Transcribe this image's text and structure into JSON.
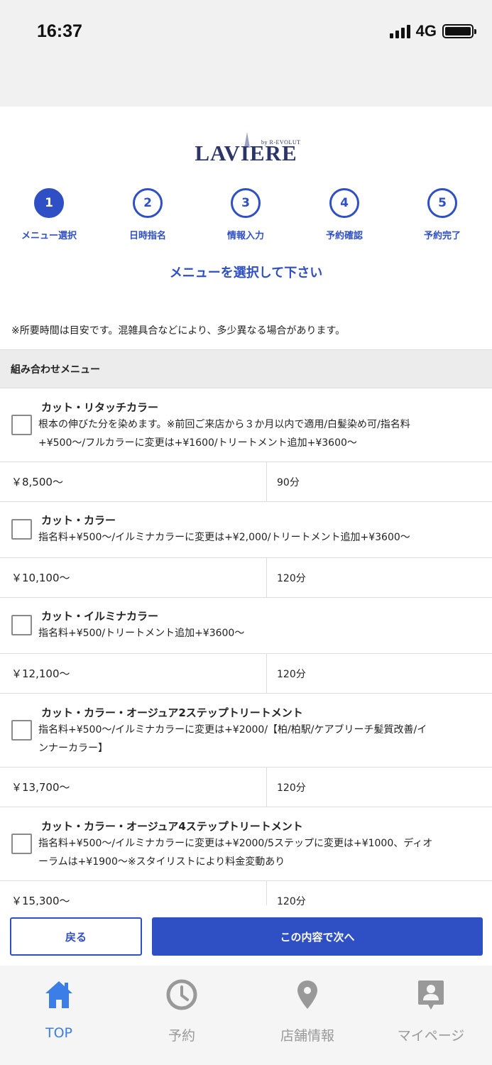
{
  "status_bar": {
    "time": "16:37",
    "network": "4G"
  },
  "logo": {
    "by": "by R-EVOLUT",
    "name": "LAVIERE"
  },
  "steps": [
    {
      "number": "1",
      "label": "メニュー選択",
      "active": true
    },
    {
      "number": "2",
      "label": "日時指名",
      "active": false
    },
    {
      "number": "3",
      "label": "情報入力",
      "active": false
    },
    {
      "number": "4",
      "label": "予約確認",
      "active": false
    },
    {
      "number": "5",
      "label": "予約完了",
      "active": false
    }
  ],
  "heading": "メニューを選択して下さい",
  "note": "※所要時間は目安です。混雑具合などにより、多少異なる場合があります。",
  "section": {
    "title": "組み合わせメニュー"
  },
  "menu_items": [
    {
      "name": "カット・リタッチカラー",
      "desc_lines": [
        "根本の伸びた分を染めます。※前回ご来店から３か月以内で適用/白髪染め可/指名料",
        "+¥500〜/フルカラーに変更は+¥1600/トリートメント追加+¥3600〜"
      ],
      "price": "￥8,500〜",
      "duration": "90分",
      "checked": false
    },
    {
      "name": "カット・カラー",
      "desc_lines": [
        "指名料+¥500〜/イルミナカラーに変更は+¥2,000/トリートメント追加+¥3600〜"
      ],
      "price": "￥10,100〜",
      "duration": "120分",
      "checked": false
    },
    {
      "name": "カット・イルミナカラー",
      "desc_lines": [
        "指名料+¥500/トリートメント追加+¥3600〜"
      ],
      "price": "￥12,100〜",
      "duration": "120分",
      "checked": false
    },
    {
      "name": "カット・カラー・オージュア2ステップトリートメント",
      "desc_lines": [
        "指名料+¥500〜/イルミナカラーに変更は+¥2000/【柏/柏駅/ケアブリーチ髪質改善/イ",
        "ンナーカラー】"
      ],
      "price": "￥13,700〜",
      "duration": "120分",
      "checked": false
    },
    {
      "name": "カット・カラー・オージュア4ステップトリートメント",
      "desc_lines": [
        "指名料+¥500〜/イルミナカラーに変更は+¥2000/5ステップに変更は+¥1000、ディオ",
        "ーラムは+¥1900〜※スタイリストにより料金変動あり"
      ],
      "price": "￥15,300〜",
      "duration": "120分",
      "checked": false
    }
  ],
  "buttons": {
    "back": "戻る",
    "next": "この内容で次へ"
  },
  "tabbar": [
    {
      "label": "TOP",
      "icon": "home-icon",
      "active": true
    },
    {
      "label": "予約",
      "icon": "clock-icon",
      "active": false
    },
    {
      "label": "店舗情報",
      "icon": "map-pin-icon",
      "active": false
    },
    {
      "label": "マイページ",
      "icon": "user-card-icon",
      "active": false
    }
  ],
  "colors": {
    "accent": "#2f4fc4",
    "tab_active": "#3b7ee8",
    "tab_inactive": "#999999",
    "logo": "#2b3566"
  }
}
